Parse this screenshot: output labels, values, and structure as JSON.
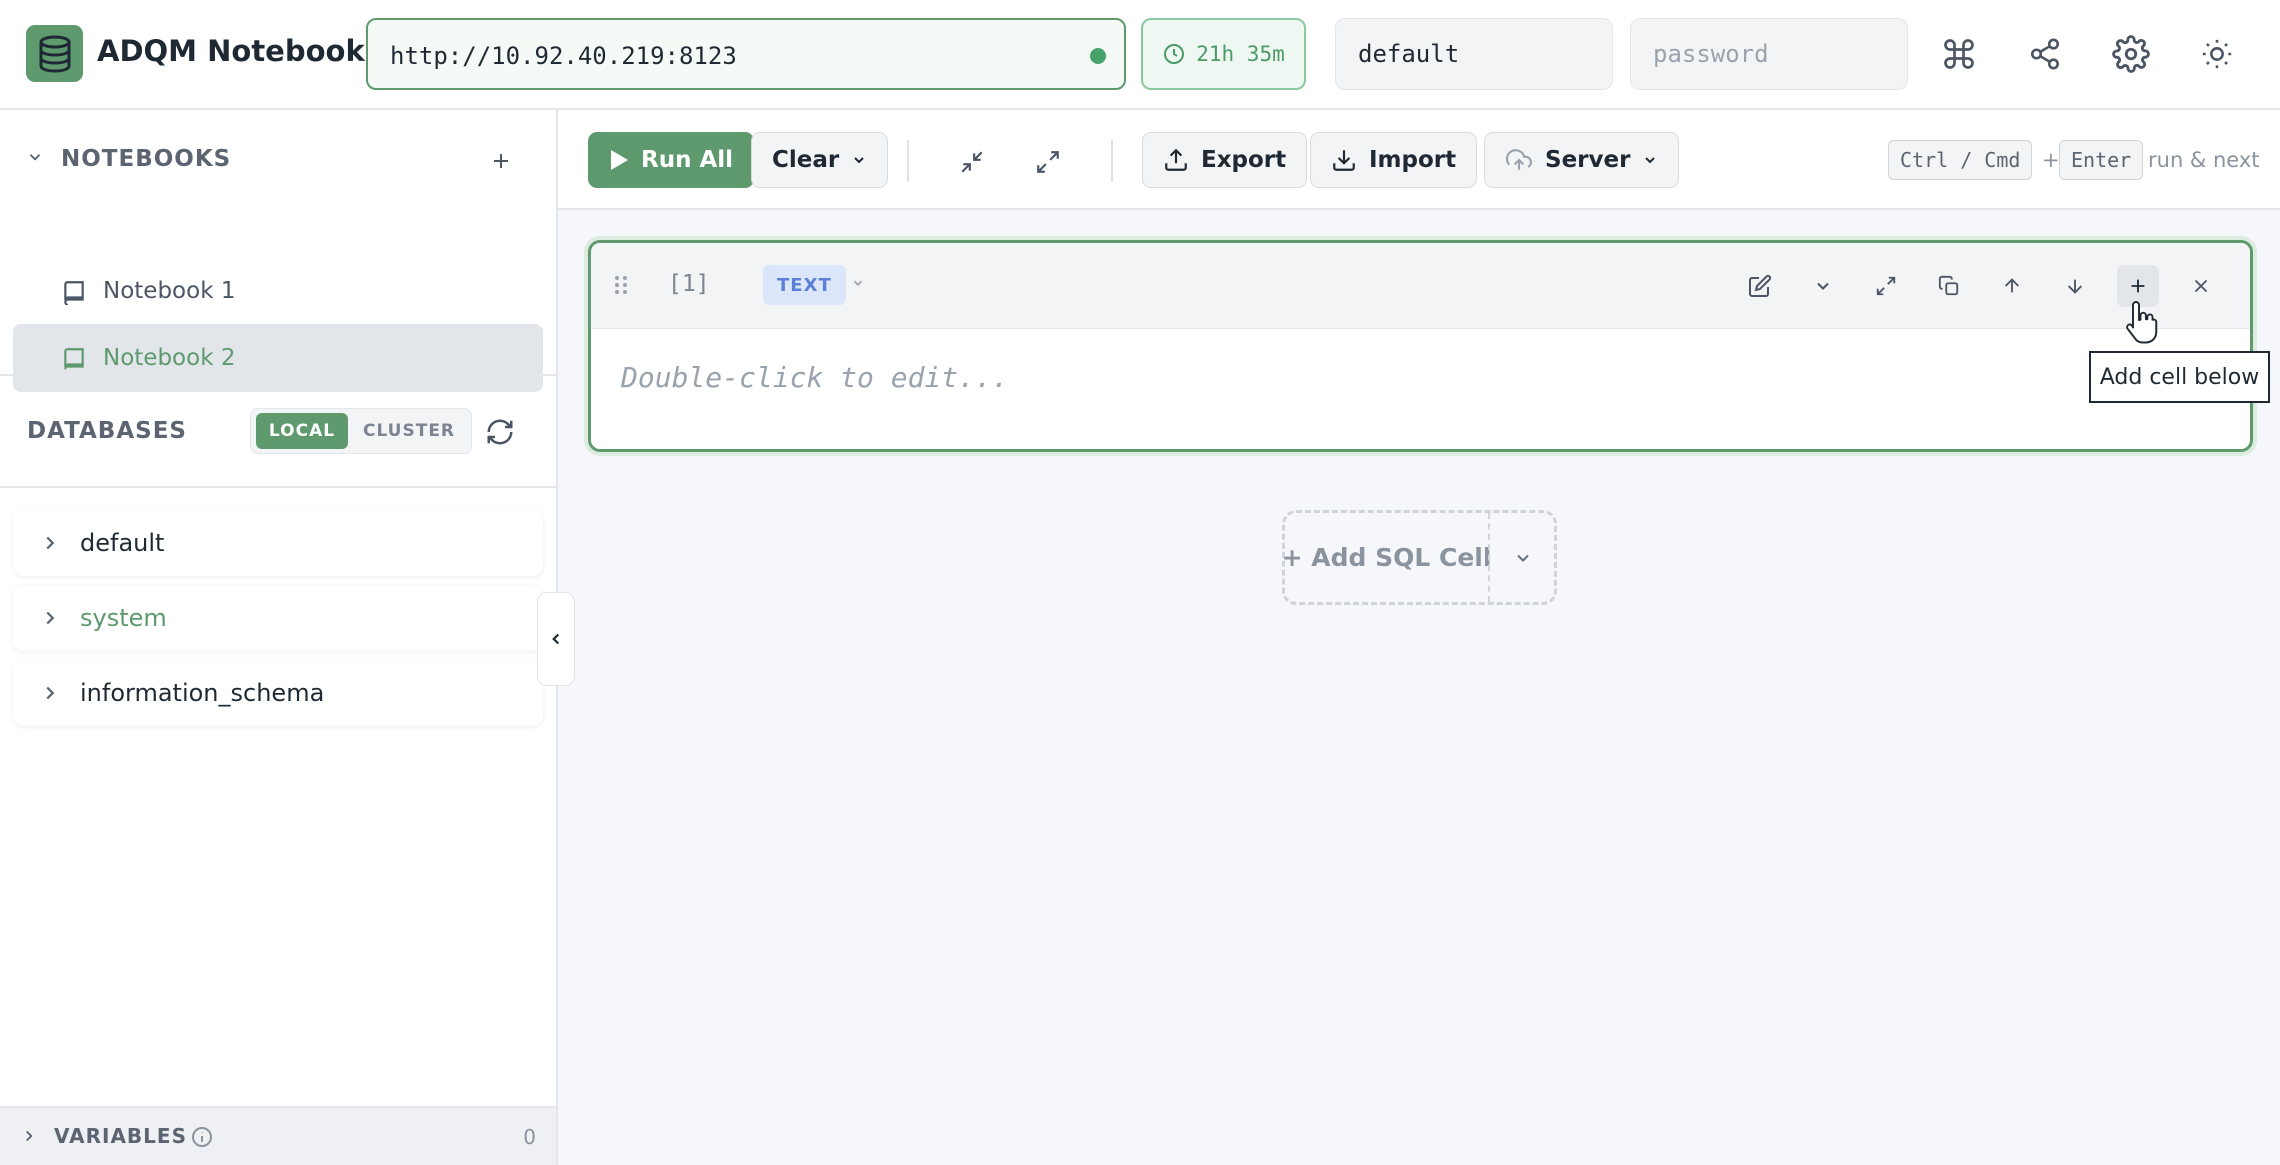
{
  "app": {
    "title": "ADQM Notebook",
    "logo_icon": "database-icon"
  },
  "connection": {
    "url": "http://10.92.40.219:8123",
    "status_color": "#47a36b",
    "session_timer": "21h 35m",
    "username": "default",
    "password_placeholder": "password"
  },
  "header_icons": [
    "command-icon",
    "share-icon",
    "settings-icon",
    "theme-sun-icon"
  ],
  "sidebar": {
    "notebooks_label": "NOTEBOOKS",
    "notebooks": [
      {
        "label": "Notebook 1",
        "active": false
      },
      {
        "label": "Notebook 2",
        "active": true
      }
    ],
    "databases_label": "DATABASES",
    "scope_options": [
      "LOCAL",
      "CLUSTER"
    ],
    "scope_selected": "LOCAL",
    "databases": [
      "default",
      "system",
      "information_schema"
    ],
    "variables_label": "VARIABLES",
    "variables_count": "0"
  },
  "toolbar": {
    "run_all": "Run All",
    "clear": "Clear",
    "export": "Export",
    "import": "Import",
    "server": "Server",
    "shortcut_key1": "Ctrl / Cmd",
    "shortcut_plus": "+",
    "shortcut_key2": "Enter",
    "shortcut_hint": "run & next"
  },
  "cell": {
    "number": "[1]",
    "type": "TEXT",
    "placeholder": "Double-click to edit...",
    "tooltip": "Add cell below"
  },
  "add_cell": {
    "label": "+ Add SQL Cell"
  },
  "colors": {
    "accent": "#5e9a6e",
    "text_badge_bg": "#dbe6fb",
    "text_badge_fg": "#5b80d6"
  }
}
